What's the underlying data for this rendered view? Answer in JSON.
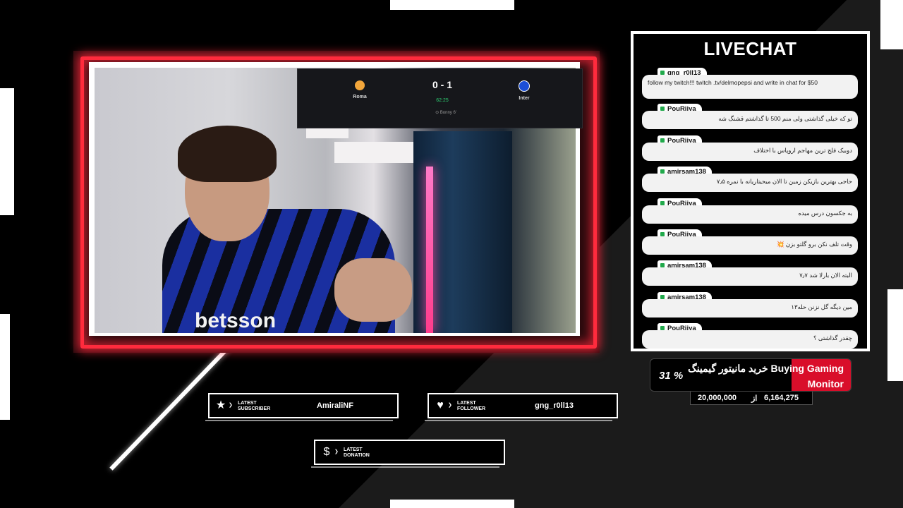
{
  "score": {
    "home_team": "Roma",
    "away_team": "Inter",
    "score": "0 - 1",
    "time": "62:25",
    "event": "Bonny 6'",
    "home_color": "#f2a63b",
    "away_color": "#1b4fd6"
  },
  "camera": {
    "sponsor_text": "betsson"
  },
  "chat": {
    "title": "LIVECHAT",
    "messages": [
      {
        "user": "gng_r0ll13",
        "text": "follow my twitch!!! twitch .tv/delmopepsi and write in chat for $50"
      },
      {
        "user": "PouRiiya",
        "text": "تو که خیلی گذاشتی ولی منم 500 تا گذاشتم قشنگ شه"
      },
      {
        "user": "PouRiiya",
        "text": "دوبیک فلج ترین مهاجم اروپاس با اختلاف"
      },
      {
        "user": "amirsam138",
        "text": "حاجی بهترین بازیکن زمین تا الان میحیتاریانه با نمره ۷٫۵"
      },
      {
        "user": "PouRiiya",
        "text": "به جکسون درس میده"
      },
      {
        "user": "PouRiiya",
        "text": "وقت تلف نکن برو گلتو بزن 💥"
      },
      {
        "user": "amirsam138",
        "text": "البته الان بارلا شد ۷٫۷"
      },
      {
        "user": "amirsam138",
        "text": "مین دیگه گل نزنن حله۱۳"
      },
      {
        "user": "PouRiiya",
        "text": "چقدر گذاشتی ؟"
      }
    ]
  },
  "goal": {
    "title": "خرید مانیتور گیمینگ Buying Gaming Monitor",
    "percent_label": "31 %",
    "progress_fraction": 0.31,
    "current": "6,164,275",
    "separator": "از",
    "target": "20,000,000",
    "fill_color": "#d90e2a"
  },
  "latest": {
    "subscriber": {
      "label_line1": "LATEST",
      "label_line2": "SUBSCRIBER",
      "value": "AmiraliNF",
      "icon": "star-icon"
    },
    "follower": {
      "label_line1": "LATEST",
      "label_line2": "FOLLOWER",
      "value": "gng_r0ll13",
      "icon": "heart-icon"
    },
    "donation": {
      "label_line1": "LATEST",
      "label_line2": "DONATION",
      "value": "",
      "icon": "dollar-icon"
    }
  }
}
